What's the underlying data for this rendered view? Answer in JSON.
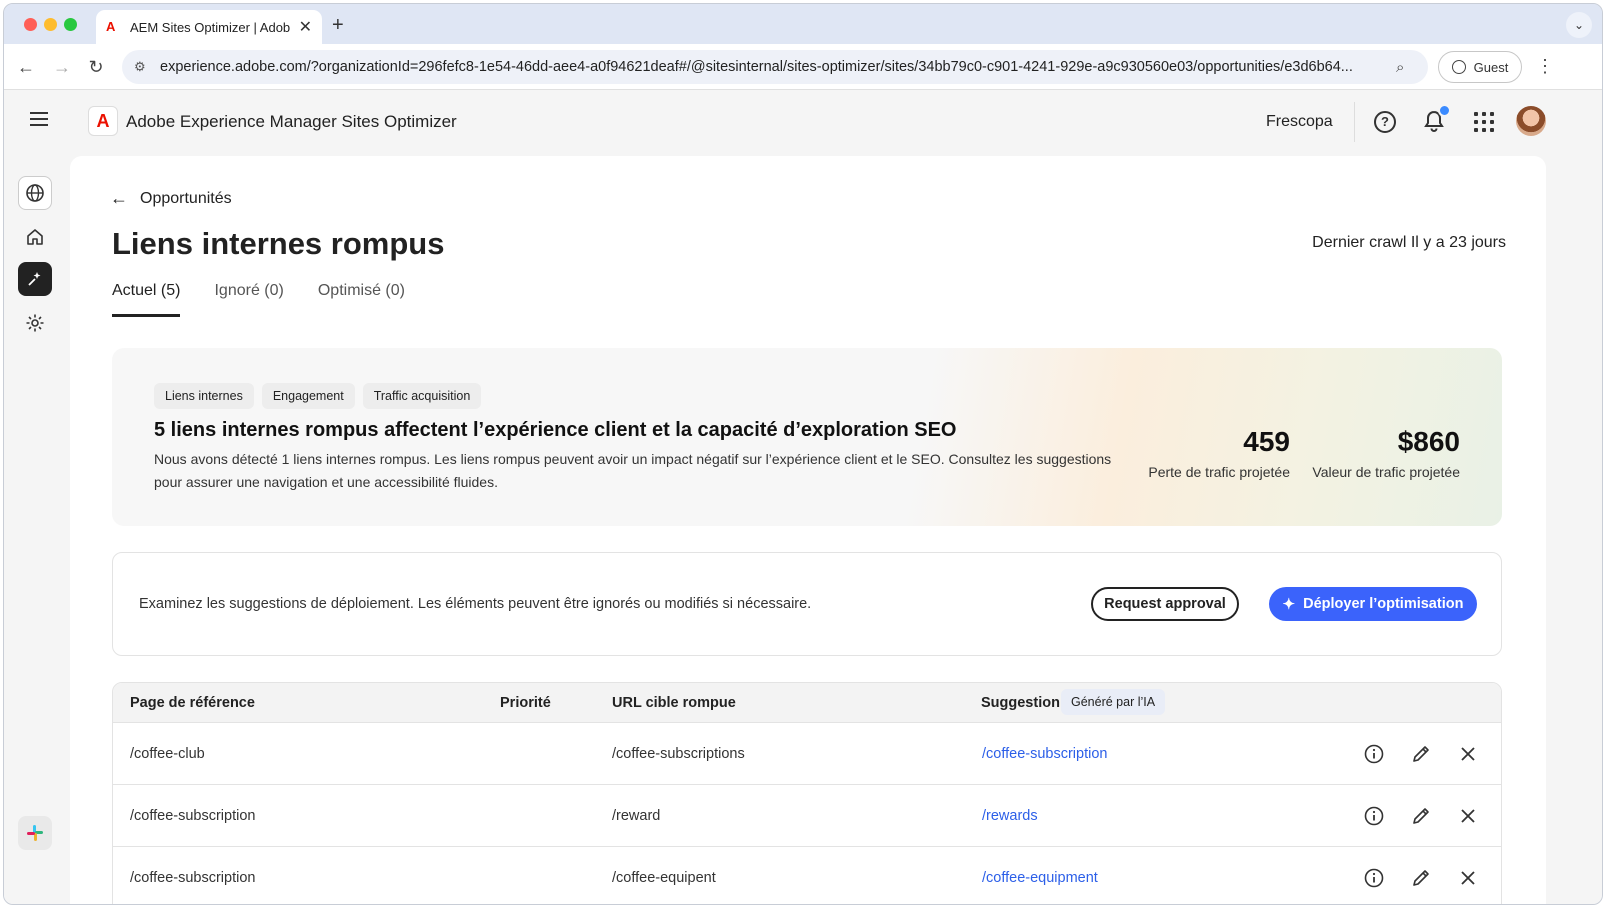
{
  "browser": {
    "tab_title": "AEM Sites Optimizer | Adobe",
    "url": "experience.adobe.com/?organizationId=296fefc8-1e54-46dd-aee4-a0f94621deaf#/@sitesinternal/sites-optimizer/sites/34bb79c0-c901-4241-929e-a9c930560e03/opportunities/e3d6b64...",
    "profile_label": "Guest"
  },
  "header": {
    "app_title": "Adobe Experience Manager Sites Optimizer",
    "org_name": "Frescopa"
  },
  "page": {
    "back_label": "Opportunités",
    "title": "Liens internes rompus",
    "last_crawl": "Dernier crawl Il y a 23 jours",
    "tabs": [
      {
        "label": "Actuel (5)",
        "active": true
      },
      {
        "label": "Ignoré (0)",
        "active": false
      },
      {
        "label": "Optimisé (0)",
        "active": false
      }
    ]
  },
  "banner": {
    "tags": [
      "Liens internes",
      "Engagement",
      "Traffic acquisition"
    ],
    "title": "5 liens internes rompus affectent l’expérience client et la capacité d’exploration SEO",
    "description": "Nous avons détecté 1 liens internes rompus. Les liens rompus peuvent avoir un impact négatif sur l’expérience client et le SEO. Consultez les suggestions pour assurer une navigation et une accessibilité fluides.",
    "metrics": [
      {
        "value": "459",
        "label": "Perte de trafic projetée"
      },
      {
        "value": "$860",
        "label": "Valeur de trafic projetée"
      }
    ]
  },
  "action_bar": {
    "text": "Examinez les suggestions de déploiement. Les éléments peuvent être ignorés ou modifiés si nécessaire.",
    "request_label": "Request approval",
    "deploy_label": "Déployer l’optimisation"
  },
  "table": {
    "headers": {
      "referrer": "Page de référence",
      "priority": "Priorité",
      "broken_url": "URL cible rompue",
      "suggestion": "Suggestion",
      "ai_badge": "Généré par l’IA"
    },
    "rows": [
      {
        "referrer": "/coffee-club",
        "priority": "",
        "broken_url": "/coffee-subscriptions",
        "suggestion": "/coffee-subscription"
      },
      {
        "referrer": "/coffee-subscription",
        "priority": "",
        "broken_url": "/reward",
        "suggestion": "/rewards"
      },
      {
        "referrer": "/coffee-subscription",
        "priority": "",
        "broken_url": "/coffee-equipent",
        "suggestion": "/coffee-equipment"
      }
    ]
  },
  "colors": {
    "accent": "#3b63fb",
    "link": "#2c5fe8",
    "brand_red": "#eb1000",
    "notification": "#3b8bff"
  }
}
